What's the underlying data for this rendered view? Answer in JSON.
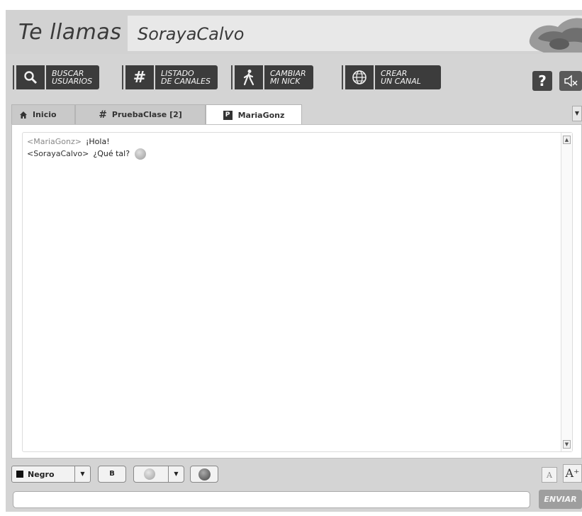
{
  "header": {
    "title": "Te llamas",
    "nick": "SorayaCalvo"
  },
  "toolbar": {
    "buttons": [
      {
        "line1": "BUSCAR",
        "line2": "USUARIOS",
        "icon": "search-icon"
      },
      {
        "line1": "LISTADO",
        "line2": "DE CANALES",
        "icon": "hash-icon"
      },
      {
        "line1": "CAMBIAR",
        "line2": "MI NICK",
        "icon": "walking-person-icon"
      },
      {
        "line1": "CREAR",
        "line2": "UN CANAL",
        "icon": "globe-icon"
      }
    ],
    "help_label": "?",
    "mute_icon": "speaker-muted-icon"
  },
  "tabs": [
    {
      "label": "Inicio",
      "icon": "home-icon",
      "active": false
    },
    {
      "label": "PruebaClase [2]",
      "icon": "hash-icon",
      "active": false
    },
    {
      "label": "MariaGonz",
      "icon": "private-badge-icon",
      "badge": "P",
      "active": true
    }
  ],
  "chat": {
    "messages": [
      {
        "nick": "<MariaGonz>",
        "text": "¡Hola!",
        "own": false,
        "emoticon": false
      },
      {
        "nick": "<SorayaCalvo>",
        "text": "¿Qué tal?",
        "own": true,
        "emoticon": true
      }
    ]
  },
  "controls": {
    "color_label": "Negro",
    "color_value": "#111111",
    "bold_label": "B",
    "font_small_label": "A",
    "font_big_label": "A⁺"
  },
  "input": {
    "value": "",
    "send_label": "ENVIAR"
  }
}
